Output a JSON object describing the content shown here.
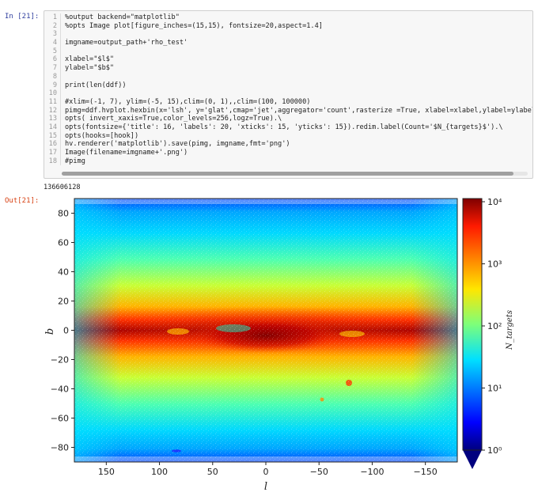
{
  "cell": {
    "in_prompt": "In [21]:",
    "out_prompt": "Out[21]:",
    "lines": [
      {
        "n": "1",
        "text": "%output backend=\"matplotlib\""
      },
      {
        "n": "2",
        "text": "%opts Image plot[figure_inches=(15,15), fontsize=20,aspect=1.4]"
      },
      {
        "n": "3",
        "text": ""
      },
      {
        "n": "4",
        "text": "imgname=output_path+'rho_test'"
      },
      {
        "n": "5",
        "text": ""
      },
      {
        "n": "6",
        "text": "xlabel=\"$l$\""
      },
      {
        "n": "7",
        "text": "ylabel=\"$b$\""
      },
      {
        "n": "8",
        "text": ""
      },
      {
        "n": "9",
        "text": "print(len(ddf))"
      },
      {
        "n": "10",
        "text": ""
      },
      {
        "n": "11",
        "text": "#xlim=(-1, 7), ylim=(-5, 15),clim=(0, 1),,clim=(100, 100000)"
      },
      {
        "n": "12",
        "text": "pimg=ddf.hvplot.hexbin(x='lsh', y='glat',cmap='jet',aggregator='count',rasterize =True, xlabel=xlabel,ylabel=ylabel)."
      },
      {
        "n": "13",
        "text": "opts( invert_xaxis=True,color_levels=256,logz=True).\\"
      },
      {
        "n": "14",
        "text": "opts(fontsize={'title': 16, 'labels': 20, 'xticks': 15, 'yticks': 15}).redim.label(Count='$N_{targets}$').\\"
      },
      {
        "n": "15",
        "text": "opts(hooks=[hook])"
      },
      {
        "n": "16",
        "text": "hv.renderer('matplotlib').save(pimg, imgname,fmt='png')"
      },
      {
        "n": "17",
        "text": "Image(filename=imgname+'.png')"
      },
      {
        "n": "18",
        "text": "#pimg"
      }
    ],
    "stdout": "136606128"
  },
  "chart_data": {
    "type": "heatmap",
    "title": "",
    "xlabel": "l",
    "ylabel": "b",
    "xlim": [
      180,
      -180
    ],
    "ylim": [
      -90,
      90
    ],
    "x_ticks": [
      150,
      100,
      50,
      0,
      -50,
      -100,
      -150
    ],
    "y_ticks": [
      -80,
      -60,
      -40,
      -20,
      0,
      20,
      40,
      60,
      80
    ],
    "colorbar": {
      "label": "N_targets",
      "scale": "log",
      "ticks": [
        "10⁰",
        "10¹",
        "10²",
        "10³",
        "10⁴"
      ],
      "cmap": "jet"
    },
    "x_tick_labels": [
      "150",
      "100",
      "50",
      "0",
      "−50",
      "−100",
      "−150"
    ],
    "y_tick_labels": [
      "−80",
      "−60",
      "−40",
      "−20",
      "0",
      "20",
      "40",
      "60",
      "80"
    ]
  }
}
